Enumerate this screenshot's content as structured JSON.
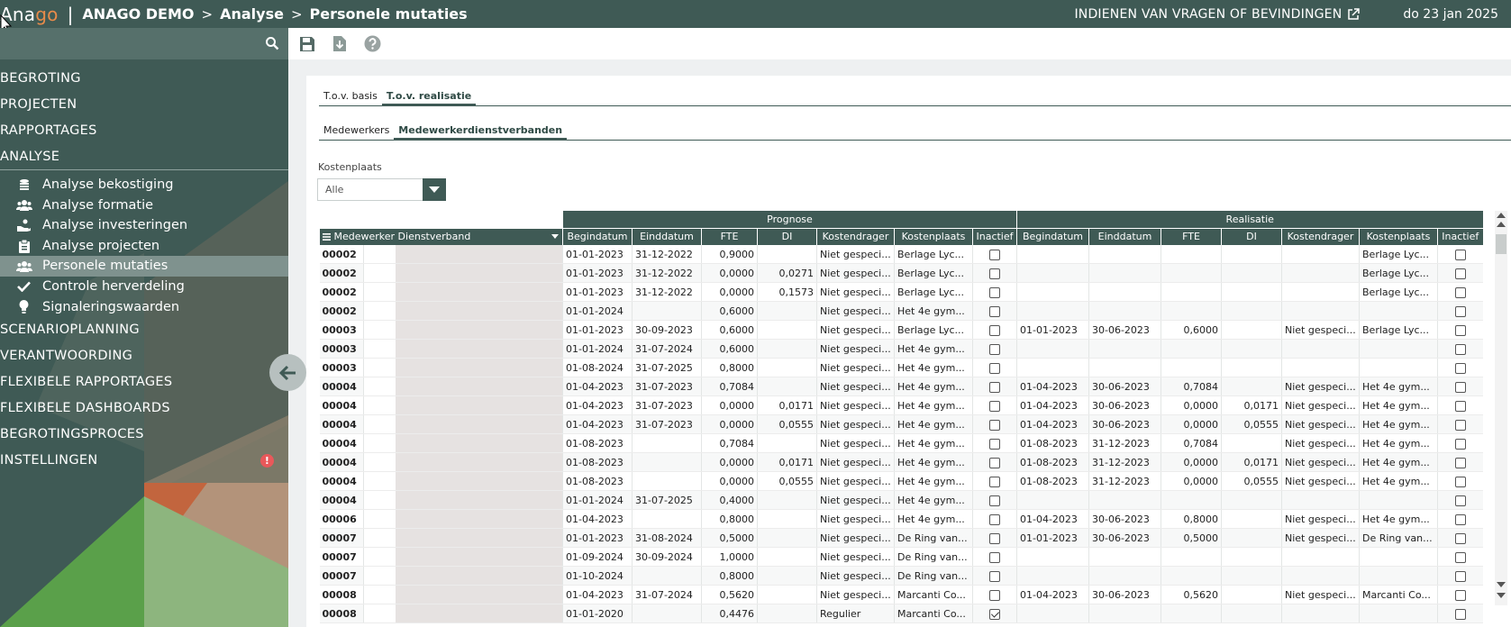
{
  "header": {
    "logo_pre": "Ana",
    "logo_post": "go",
    "separator": "|",
    "crumbs": [
      "ANAGO DEMO",
      "Analyse",
      "Personele mutaties"
    ],
    "crumb_sep": ">",
    "feedback": "INDIENEN VAN VRAGEN OF BEVINDINGEN",
    "date": "do 23 jan 2025"
  },
  "sidebar": {
    "top1": [
      "BEGROTING",
      "PROJECTEN",
      "RAPPORTAGES",
      "ANALYSE"
    ],
    "sub": [
      {
        "label": "Analyse bekostiging",
        "icon": "coins-icon"
      },
      {
        "label": "Analyse formatie",
        "icon": "users-icon"
      },
      {
        "label": "Analyse investeringen",
        "icon": "hand-coins-icon"
      },
      {
        "label": "Analyse projecten",
        "icon": "clipboard-icon"
      },
      {
        "label": "Personele mutaties",
        "icon": "users-icon"
      },
      {
        "label": "Controle herverdeling",
        "icon": "check-icon"
      },
      {
        "label": "Signaleringswaarden",
        "icon": "lightbulb-icon"
      }
    ],
    "top2": [
      "SCENARIOPLANNING",
      "VERANTWOORDING",
      "FLEXIBELE RAPPORTAGES",
      "FLEXIBELE DASHBOARDS",
      "BEGROTINGSPROCES",
      "INSTELLINGEN"
    ],
    "warn_glyph": "!"
  },
  "tabs1": [
    "T.o.v. basis",
    "T.o.v. realisatie"
  ],
  "tabs2": [
    "Medewerkers",
    "Medewerkerdienstverbanden"
  ],
  "filter": {
    "label": "Kostenplaats",
    "value": "Alle"
  },
  "grid": {
    "group_prognose": "Prognose",
    "group_realisatie": "Realisatie",
    "col_first": "Medewerker Dienstverband",
    "cols": [
      "Begindatum",
      "Einddatum",
      "FTE",
      "DI",
      "Kostendrager",
      "Kostenplaats",
      "Inactief"
    ],
    "rows": [
      [
        "00002",
        "01-01-2023",
        "31-12-2022",
        "0,9000",
        "",
        "Niet gespeci...",
        "Berlage Lyc...",
        false,
        "",
        "",
        "",
        "",
        "",
        "Berlage Lyc...",
        false
      ],
      [
        "00002",
        "01-01-2023",
        "31-12-2022",
        "0,0000",
        "0,0271",
        "Niet gespeci...",
        "Berlage Lyc...",
        false,
        "",
        "",
        "",
        "",
        "",
        "Berlage Lyc...",
        false
      ],
      [
        "00002",
        "01-01-2023",
        "31-12-2022",
        "0,0000",
        "0,1573",
        "Niet gespeci...",
        "Berlage Lyc...",
        false,
        "",
        "",
        "",
        "",
        "",
        "Berlage Lyc...",
        false
      ],
      [
        "00002",
        "01-01-2024",
        "",
        "0,6000",
        "",
        "Niet gespeci...",
        "Het 4e gym...",
        false,
        "",
        "",
        "",
        "",
        "",
        "",
        false
      ],
      [
        "00003",
        "01-01-2023",
        "30-09-2023",
        "0,6000",
        "",
        "Niet gespeci...",
        "Berlage Lyc...",
        false,
        "01-01-2023",
        "30-06-2023",
        "0,6000",
        "",
        "Niet gespeci...",
        "Berlage Lyc...",
        false
      ],
      [
        "00003",
        "01-01-2024",
        "31-07-2024",
        "0,6000",
        "",
        "Niet gespeci...",
        "Het 4e gym...",
        false,
        "",
        "",
        "",
        "",
        "",
        "",
        false
      ],
      [
        "00003",
        "01-08-2024",
        "31-07-2025",
        "0,8000",
        "",
        "Niet gespeci...",
        "Het 4e gym...",
        false,
        "",
        "",
        "",
        "",
        "",
        "",
        false
      ],
      [
        "00004",
        "01-04-2023",
        "31-07-2023",
        "0,7084",
        "",
        "Niet gespeci...",
        "Het 4e gym...",
        false,
        "01-04-2023",
        "30-06-2023",
        "0,7084",
        "",
        "Niet gespeci...",
        "Het 4e gym...",
        false
      ],
      [
        "00004",
        "01-04-2023",
        "31-07-2023",
        "0,0000",
        "0,0171",
        "Niet gespeci...",
        "Het 4e gym...",
        false,
        "01-04-2023",
        "30-06-2023",
        "0,0000",
        "0,0171",
        "Niet gespeci...",
        "Het 4e gym...",
        false
      ],
      [
        "00004",
        "01-04-2023",
        "31-07-2023",
        "0,0000",
        "0,0555",
        "Niet gespeci...",
        "Het 4e gym...",
        false,
        "01-04-2023",
        "30-06-2023",
        "0,0000",
        "0,0555",
        "Niet gespeci...",
        "Het 4e gym...",
        false
      ],
      [
        "00004",
        "01-08-2023",
        "",
        "0,7084",
        "",
        "Niet gespeci...",
        "Het 4e gym...",
        false,
        "01-08-2023",
        "31-12-2023",
        "0,7084",
        "",
        "Niet gespeci...",
        "Het 4e gym...",
        false
      ],
      [
        "00004",
        "01-08-2023",
        "",
        "0,0000",
        "0,0171",
        "Niet gespeci...",
        "Het 4e gym...",
        false,
        "01-08-2023",
        "31-12-2023",
        "0,0000",
        "0,0171",
        "Niet gespeci...",
        "Het 4e gym...",
        false
      ],
      [
        "00004",
        "01-08-2023",
        "",
        "0,0000",
        "0,0555",
        "Niet gespeci...",
        "Het 4e gym...",
        false,
        "01-08-2023",
        "31-12-2023",
        "0,0000",
        "0,0555",
        "Niet gespeci...",
        "Het 4e gym...",
        false
      ],
      [
        "00004",
        "01-01-2024",
        "31-07-2025",
        "0,4000",
        "",
        "Niet gespeci...",
        "Het 4e gym...",
        false,
        "",
        "",
        "",
        "",
        "",
        "",
        false
      ],
      [
        "00006",
        "01-04-2023",
        "",
        "0,8000",
        "",
        "Niet gespeci...",
        "Het 4e gym...",
        false,
        "01-04-2023",
        "30-06-2023",
        "0,8000",
        "",
        "Niet gespeci...",
        "Het 4e gym...",
        false
      ],
      [
        "00007",
        "01-01-2023",
        "31-08-2024",
        "0,5000",
        "",
        "Niet gespeci...",
        "De Ring van...",
        false,
        "01-01-2023",
        "30-06-2023",
        "0,5000",
        "",
        "Niet gespeci...",
        "De Ring van...",
        false
      ],
      [
        "00007",
        "01-09-2024",
        "30-09-2024",
        "1,0000",
        "",
        "Niet gespeci...",
        "De Ring van...",
        false,
        "",
        "",
        "",
        "",
        "",
        "",
        false
      ],
      [
        "00007",
        "01-10-2024",
        "",
        "0,8000",
        "",
        "Niet gespeci...",
        "De Ring van...",
        false,
        "",
        "",
        "",
        "",
        "",
        "",
        false
      ],
      [
        "00008",
        "01-04-2023",
        "31-07-2024",
        "0,5620",
        "",
        "Niet gespeci...",
        "Marcanti Co...",
        false,
        "01-04-2023",
        "30-06-2023",
        "0,5620",
        "",
        "Niet gespeci...",
        "Marcanti Co...",
        false
      ],
      [
        "00008",
        "01-01-2020",
        "",
        "0,4476",
        "",
        "Regulier",
        "Marcanti Co...",
        true,
        "",
        "",
        "",
        "",
        "",
        "",
        false
      ]
    ]
  },
  "colors": {
    "brand": "#3f5a55",
    "logo_accent": "#e88b4a",
    "warn": "#e9585a"
  }
}
